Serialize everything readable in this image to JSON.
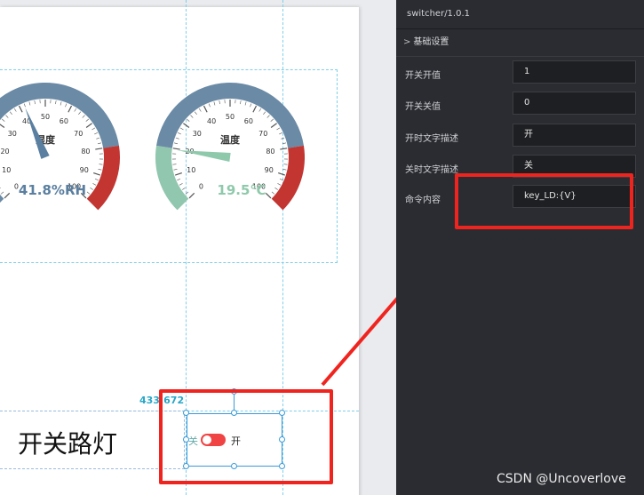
{
  "panel": {
    "component_version": "switcher/1.0.1",
    "section_title": "基础设置",
    "fields": [
      {
        "label": "开关开值",
        "value": "1"
      },
      {
        "label": "开关关值",
        "value": "0"
      },
      {
        "label": "开时文字描述",
        "value": "开"
      },
      {
        "label": "关时文字描述",
        "value": "关"
      },
      {
        "label": "命令内容",
        "value": "key_LD:{V}"
      }
    ]
  },
  "gauges": [
    {
      "title": "湿度",
      "value_text": "41.8%RH",
      "value": 41.8,
      "ticks": [
        "0",
        "10",
        "20",
        "30",
        "40",
        "50",
        "60",
        "70",
        "80",
        "90",
        "100"
      ],
      "value_color": "#5a7fa0"
    },
    {
      "title": "温度",
      "value_text": "19.5℃",
      "value": 19.5,
      "ticks": [
        "0",
        "10",
        "20",
        "30",
        "40",
        "50",
        "60",
        "70",
        "80",
        "90",
        "100"
      ],
      "value_color": "#8fc9ab"
    }
  ],
  "canvas": {
    "coord_label": "433,672",
    "switch_label": "开关路灯",
    "toggle_on_text": "开",
    "toggle_off_text": "关"
  },
  "colors": {
    "gauge_blue": "#6a8aa6",
    "gauge_red": "#c23531",
    "gauge_green": "#91c7ae",
    "highlight_red": "#f0241f",
    "toggle_red": "#f04343"
  },
  "watermark": "CSDN @Uncoverlove"
}
